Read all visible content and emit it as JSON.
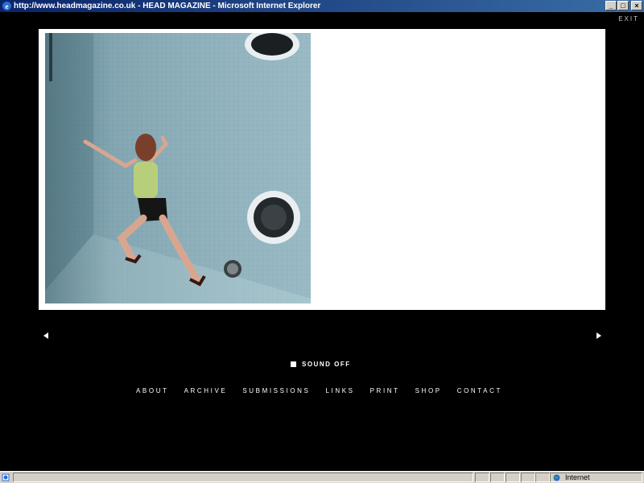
{
  "window": {
    "title": "http://www.headmagazine.co.uk - HEAD MAGAZINE - Microsoft Internet Explorer",
    "controls": [
      "minimize",
      "maximize",
      "close"
    ]
  },
  "page": {
    "exit_label": "EXIT",
    "prev_icon": "triangle-left-icon",
    "next_icon": "triangle-right-icon",
    "sound_label": "SOUND OFF",
    "nav": [
      "ABOUT",
      "ARCHIVE",
      "SUBMISSIONS",
      "LINKS",
      "PRINT",
      "SHOP",
      "CONTACT"
    ]
  },
  "statusbar": {
    "zone": "Internet"
  },
  "colors": {
    "background": "#000000",
    "titlebar_start": "#0a246a",
    "titlebar_end": "#3a6ea5",
    "frame": "#ffffff",
    "photo_tile": "#8fb3bf"
  }
}
